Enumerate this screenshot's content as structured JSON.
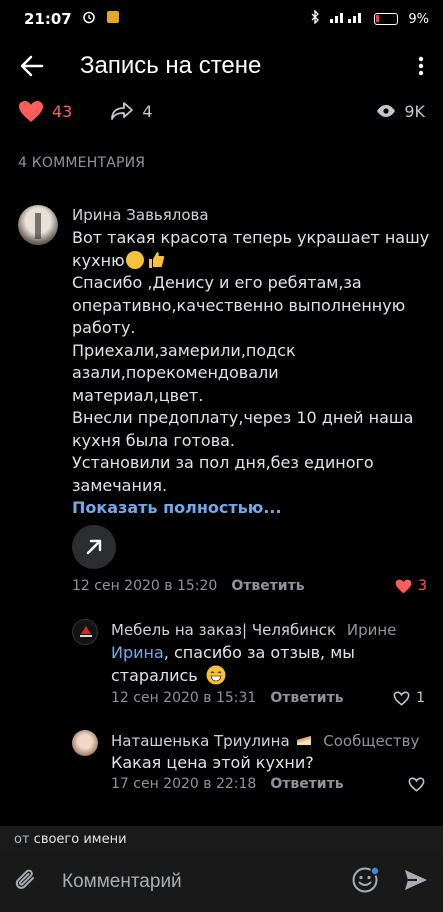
{
  "status_bar": {
    "time": "21:07",
    "battery": "9%"
  },
  "header": {
    "title": "Запись на стене"
  },
  "stats": {
    "likes": "43",
    "shares": "4",
    "views": "9K"
  },
  "comments_header": "4 КОММЕНТАРИЯ",
  "comments": [
    {
      "author": "Ирина Завьялова",
      "lines": [
        "Вот такая красота теперь украшает нашу",
        "кухню",
        "Спасибо ,Денису и его ребятам,за",
        "оперативно,качественно выполненную",
        "работу.",
        "Приехали,замерили,подск",
        "азали,порекомендовали",
        "материал,цвет.",
        "Внесли предоплату,через 10 дней наша",
        "кухня была готова.",
        "Установили за пол дня,без единого",
        "замечания."
      ],
      "show_more": "Показать полностью...",
      "date": "12 сен 2020 в 15:20",
      "reply": "Ответить",
      "likes": "3"
    },
    {
      "author": "Мебель на заказ| Челябинск",
      "to": "Ирине",
      "mention": "Ирина",
      "text_a": ", спасибо за отзыв, мы",
      "text_b": "старались",
      "date": "12 сен 2020 в 15:31",
      "reply": "Ответить",
      "likes": "1"
    },
    {
      "author": "Наташенька Триулина",
      "to": "Сообществу",
      "text": "Какая цена этой кухни?",
      "date": "17 сен 2020 в 22:18",
      "reply": "Ответить"
    }
  ],
  "composer": {
    "hint_prefix": "от",
    "hint_name": "своего имени",
    "placeholder": "Комментарий"
  },
  "colors": {
    "accent": "#71aaeb",
    "like": "#ff5c5c",
    "background": "#000000"
  }
}
